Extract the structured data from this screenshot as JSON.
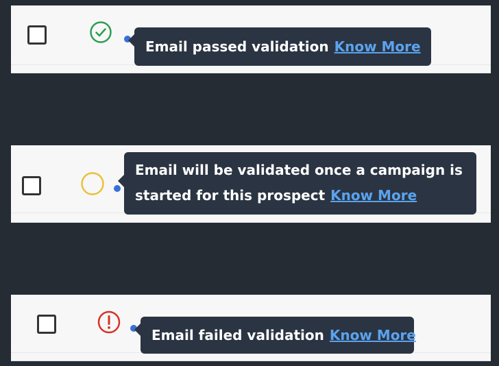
{
  "rows": [
    {
      "status": "passed",
      "status_icon": "check-circle-icon",
      "status_color": "#2e9e4f",
      "tooltip_text": "Email passed validation",
      "link_text": "Know More"
    },
    {
      "status": "pending",
      "status_icon": "circle-outline-icon",
      "status_color": "#e8c239",
      "tooltip_line1": "Email will be validated once a campaign is",
      "tooltip_line2": "started for this prospect",
      "link_text": "Know More"
    },
    {
      "status": "failed",
      "status_icon": "exclamation-circle-icon",
      "status_color": "#d93025",
      "tooltip_text": "Email failed validation",
      "link_text": "Know More"
    }
  ],
  "colors": {
    "background": "#252c34",
    "panel": "#f7f7f8",
    "tooltip_bg": "#2b3442",
    "link": "#5aa3ef"
  }
}
